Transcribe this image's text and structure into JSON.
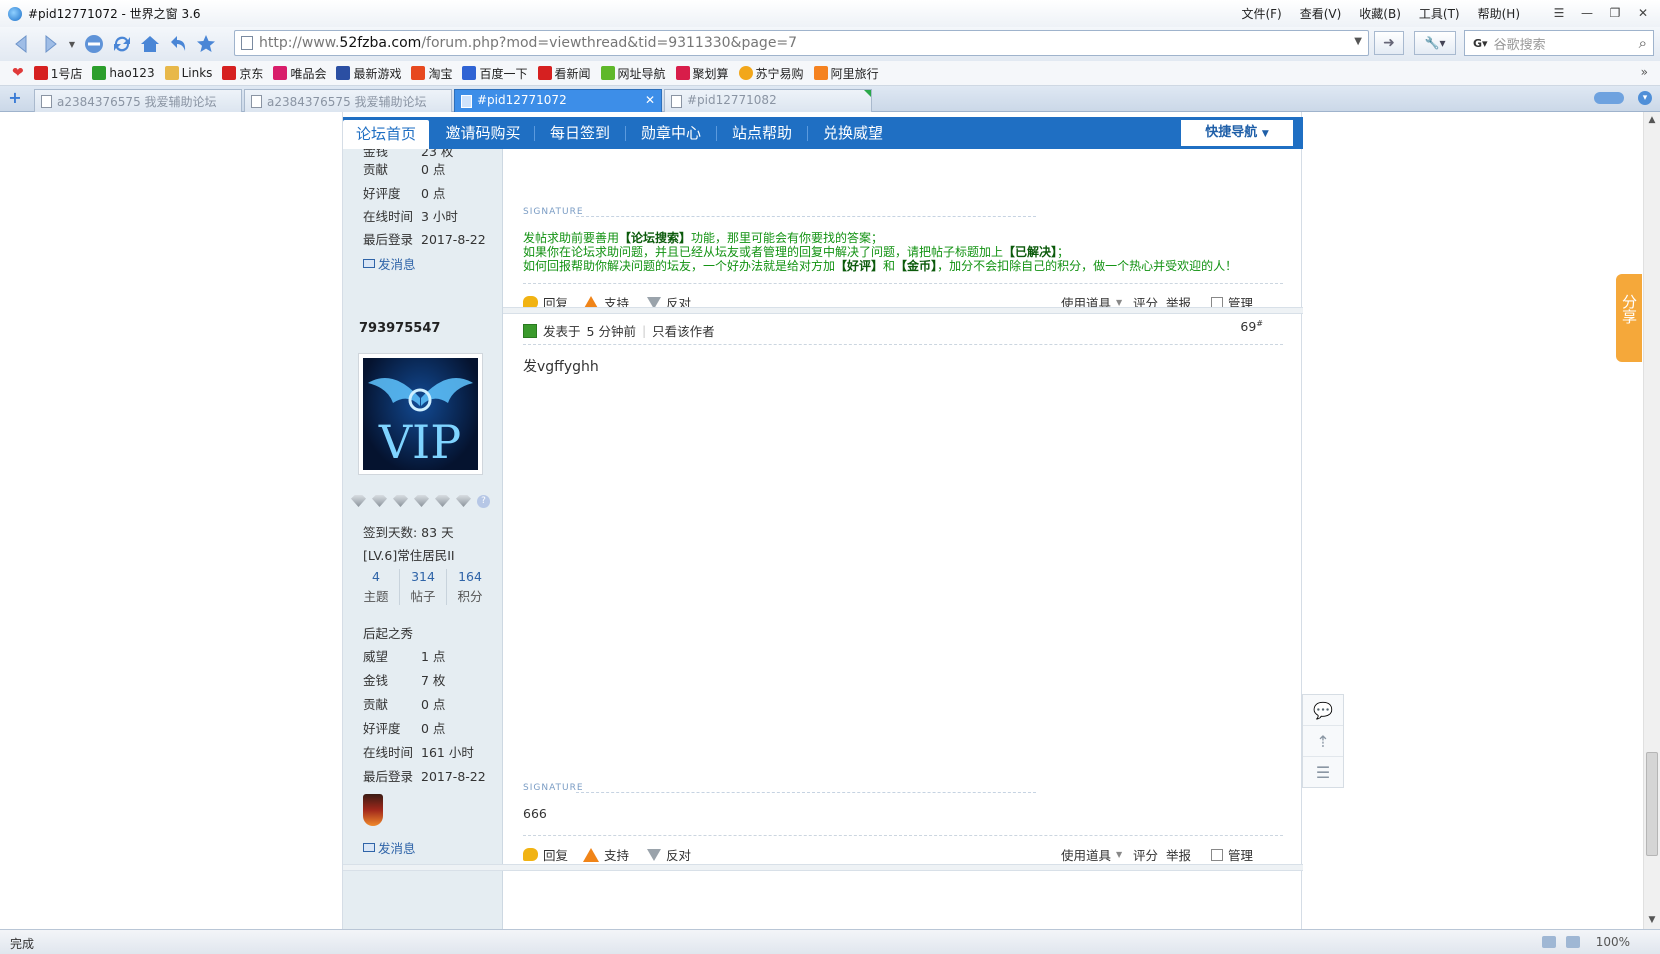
{
  "window": {
    "title": "#pid12771072 - 世界之窗 3.6",
    "menus": [
      "文件(F)",
      "查看(V)",
      "收藏(B)",
      "工具(T)",
      "帮助(H)"
    ]
  },
  "address": {
    "url_prefix": "http://www.",
    "url_domain": "52fzba.com",
    "url_path": "/forum.php?mod=viewthread&tid=9311330&page=7",
    "search_placeholder": "谷歌搜索"
  },
  "bookmarks": [
    {
      "label": "1号店",
      "color": "#d62020"
    },
    {
      "label": "hao123",
      "color": "#2c9e2c"
    },
    {
      "label": "Links",
      "color": "#e8b84a"
    },
    {
      "label": "京东",
      "color": "#d62020"
    },
    {
      "label": "唯品会",
      "color": "#d81d6a"
    },
    {
      "label": "最新游戏",
      "color": "#2b4fa3"
    },
    {
      "label": "淘宝",
      "color": "#e7491f"
    },
    {
      "label": "百度一下",
      "color": "#2f63d4"
    },
    {
      "label": "看新闻",
      "color": "#d62020"
    },
    {
      "label": "网址导航",
      "color": "#5fb82a"
    },
    {
      "label": "聚划算",
      "color": "#d81d4a"
    },
    {
      "label": "苏宁易购",
      "color": "#f2a71b"
    },
    {
      "label": "阿里旅行",
      "color": "#f58220"
    }
  ],
  "tabs": [
    {
      "label": "a2384376575 我爱辅助论坛"
    },
    {
      "label": "a2384376575 我爱辅助论坛"
    },
    {
      "label": "#pid12771072"
    },
    {
      "label": "#pid12771082"
    }
  ],
  "forum_nav": {
    "items": [
      "论坛首页",
      "邀请码购买",
      "每日签到",
      "勋章中心",
      "站点帮助",
      "兑换威望"
    ],
    "quick_nav": "快捷导航"
  },
  "post1_user": {
    "partial_stat": {
      "key": "金钱",
      "value": "23 枚"
    },
    "stats": [
      {
        "key": "贡献",
        "value": "0 点"
      },
      {
        "key": "好评度",
        "value": "0 点"
      },
      {
        "key": "在线时间",
        "value": "3 小时"
      },
      {
        "key": "最后登录",
        "value": "2017-8-22"
      }
    ],
    "message_link": "发消息"
  },
  "signature_label": "SIGNATURE",
  "forum_tips": {
    "line1_a": "发帖求助前要善用",
    "line1_b": "【论坛搜索】",
    "line1_c": "功能，那里可能会有你要找的答案；",
    "line2_a": "如果你在论坛求助问题，并且已经从坛友或者管理的回复中解决了问题，请把帖子标题加上",
    "line2_b": "【已解决】",
    "line2_c": "；",
    "line3_a": "如何回报帮助你解决问题的坛友，一个好办法就是给对方加",
    "line3_b": "【好评】",
    "line3_c": "和",
    "line3_d": "【金币】",
    "line3_e": "，加分不会扣除自己的积分，做一个热心并受欢迎的人！"
  },
  "actions": {
    "reply": "回复",
    "support": "支持",
    "oppose": "反对",
    "tools": "使用道具",
    "rate": "评分",
    "report": "举报",
    "manage": "管理"
  },
  "post2": {
    "username": "793975547",
    "avatar_text": "VIP",
    "posted": "发表于",
    "time_ago": "5 分钟前",
    "only_author": "只看该作者",
    "floor": "69",
    "floor_mark": "#",
    "body": "发vgffyghh",
    "signature": "666",
    "sign_days": "签到天数: 83 天",
    "level": "[LV.6]常住居民II",
    "counts": [
      {
        "num": "4",
        "label": "主题"
      },
      {
        "num": "314",
        "label": "帖子"
      },
      {
        "num": "164",
        "label": "积分"
      }
    ],
    "title": "后起之秀",
    "stats": [
      {
        "key": "威望",
        "value": "1 点"
      },
      {
        "key": "金钱",
        "value": "7 枚"
      },
      {
        "key": "贡献",
        "value": "0 点"
      },
      {
        "key": "好评度",
        "value": "0 点"
      },
      {
        "key": "在线时间",
        "value": "161 小时"
      },
      {
        "key": "最后登录",
        "value": "2017-8-22"
      }
    ],
    "message_link": "发消息"
  },
  "share_tab": "分享",
  "statusbar": {
    "text": "完成",
    "zoom": "100%"
  },
  "colors": {
    "forum_blue": "#1f6fc3",
    "tip_green": "#129212",
    "share_orange": "#f5a83a",
    "active_tab": "#3d8ee8"
  }
}
